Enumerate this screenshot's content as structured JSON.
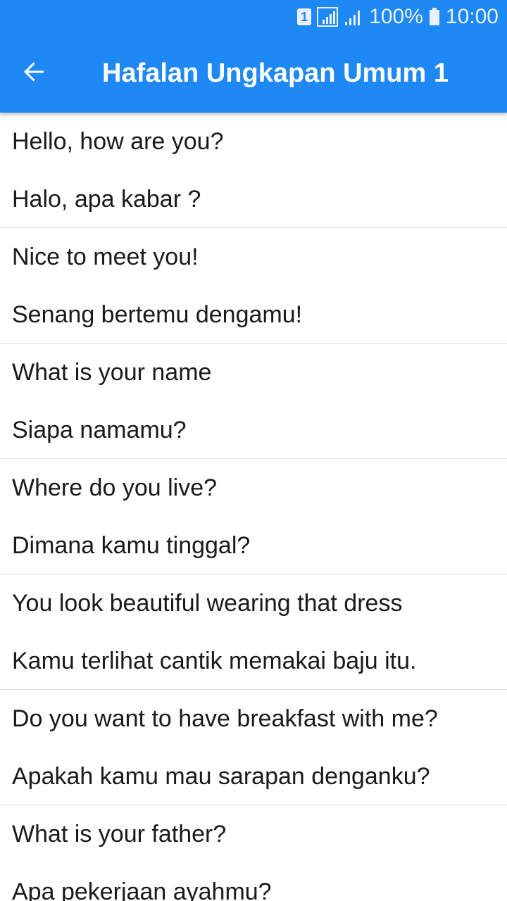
{
  "status_bar": {
    "sim": "1",
    "battery": "100%",
    "time": "10:00"
  },
  "app_bar": {
    "title": "Hafalan Ungkapan Umum 1",
    "back_icon": "arrow-left-icon",
    "background_color": "#1e88f5"
  },
  "phrases": [
    {
      "en": "Hello, how are you?",
      "id": "Halo, apa kabar ?"
    },
    {
      "en": "Nice to meet you!",
      "id": "Senang bertemu dengamu!"
    },
    {
      "en": "What is your name",
      "id": "Siapa namamu?"
    },
    {
      "en": "Where do you live?",
      "id": "Dimana kamu tinggal?"
    },
    {
      "en": "You look beautiful wearing that dress",
      "id": "Kamu terlihat cantik memakai baju itu."
    },
    {
      "en": "Do you want to have breakfast with me?",
      "id": "Apakah kamu mau sarapan denganku?"
    },
    {
      "en": "What is your father?",
      "id": "Apa pekerjaan ayahmu?"
    }
  ]
}
